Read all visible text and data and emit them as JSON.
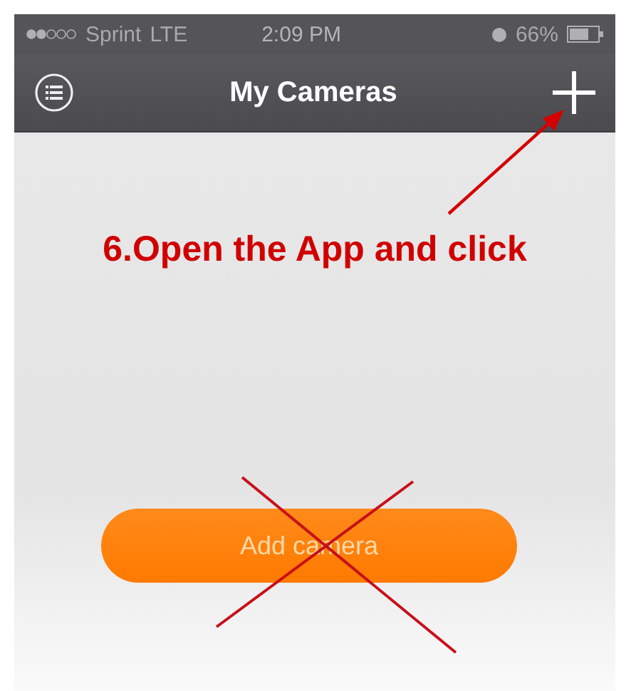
{
  "status_bar": {
    "carrier": "Sprint",
    "network": "LTE",
    "time": "2:09 PM",
    "battery": "66%"
  },
  "nav_bar": {
    "title": "My Cameras"
  },
  "instruction": {
    "text": "6.Open the App and click"
  },
  "add_button": {
    "label": "Add camera"
  },
  "annotations": [
    {
      "kind": "arrow"
    },
    {
      "kind": "cross"
    }
  ]
}
